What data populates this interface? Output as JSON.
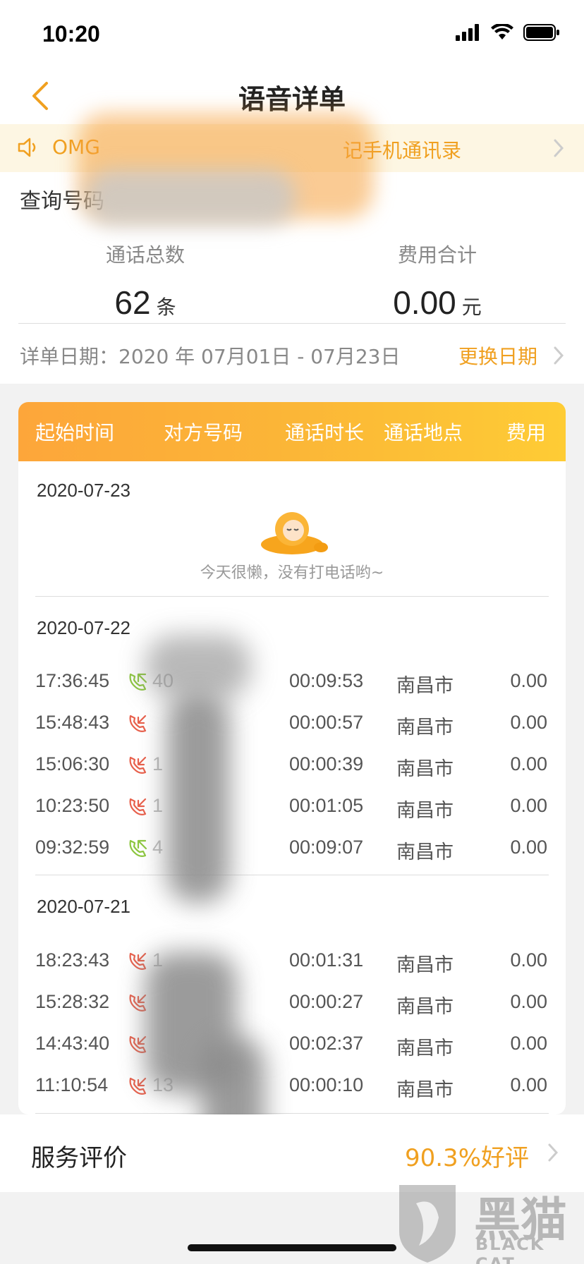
{
  "status_bar": {
    "time": "10:20"
  },
  "nav": {
    "title": "语音详单"
  },
  "notice": {
    "text_left": "OMG",
    "text_right": "记手机通讯录"
  },
  "summary": {
    "query_label": "查询号码",
    "total_calls_label": "通话总数",
    "total_calls_value": "62",
    "total_calls_unit": "条",
    "total_fee_label": "费用合计",
    "total_fee_value": "0.00",
    "total_fee_unit": "元",
    "date_range": "详单日期：2020 年 07月01日 - 07月23日",
    "change_date": "更换日期"
  },
  "table": {
    "headers": [
      "起始时间",
      "对方号码",
      "通话时长",
      "通话地点",
      "费用"
    ],
    "days": [
      {
        "date": "2020-07-23",
        "empty_text": "今天很懒，没有打电话哟~"
      },
      {
        "date": "2020-07-22",
        "calls": [
          {
            "time": "17:36:45",
            "type": "incoming",
            "number": "40",
            "duration": "00:09:53",
            "location": "南昌市",
            "fee": "0.00"
          },
          {
            "time": "15:48:43",
            "type": "outgoing",
            "number": "",
            "duration": "00:00:57",
            "location": "南昌市",
            "fee": "0.00"
          },
          {
            "time": "15:06:30",
            "type": "outgoing",
            "number": "1",
            "duration": "00:00:39",
            "location": "南昌市",
            "fee": "0.00"
          },
          {
            "time": "10:23:50",
            "type": "outgoing",
            "number": "1",
            "duration": "00:01:05",
            "location": "南昌市",
            "fee": "0.00"
          },
          {
            "time": "09:32:59",
            "type": "incoming",
            "number": "4",
            "duration": "00:09:07",
            "location": "南昌市",
            "fee": "0.00"
          }
        ]
      },
      {
        "date": "2020-07-21",
        "calls": [
          {
            "time": "18:23:43",
            "type": "outgoing",
            "number": "1",
            "duration": "00:01:31",
            "location": "南昌市",
            "fee": "0.00"
          },
          {
            "time": "15:28:32",
            "type": "outgoing",
            "number": "",
            "duration": "00:00:27",
            "location": "南昌市",
            "fee": "0.00"
          },
          {
            "time": "14:43:40",
            "type": "outgoing",
            "number": "",
            "duration": "00:02:37",
            "location": "南昌市",
            "fee": "0.00"
          },
          {
            "time": "11:10:54",
            "type": "outgoing",
            "number": "13",
            "duration": "00:00:10",
            "location": "南昌市",
            "fee": "0.00"
          }
        ]
      }
    ]
  },
  "service": {
    "label": "服务评价",
    "value": "90.3%好评"
  },
  "watermark": {
    "cn": "黑猫",
    "en": "BLACK CAT"
  },
  "colors": {
    "accent": "#f0a020",
    "incoming": "#8cc63f",
    "outgoing": "#e8604c"
  }
}
